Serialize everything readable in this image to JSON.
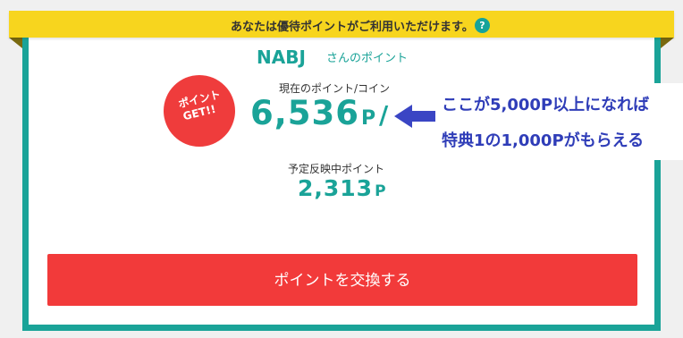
{
  "banner": {
    "text": "あなたは優待ポイントがご利用いただけます。",
    "help_icon": "?"
  },
  "user": {
    "name": "NABJ",
    "suffix": "さんのポイント"
  },
  "badge": {
    "line1": "ポイント",
    "line2": "GET!!"
  },
  "current_points": {
    "label": "現在のポイント/コイン",
    "value": "6,536",
    "unit": "P",
    "separator": "/"
  },
  "pending_points": {
    "label": "予定反映中ポイント",
    "value": "2,313",
    "unit": "P"
  },
  "annotation": {
    "line1": "ここが5,000P以上になれば",
    "line2": "特典1の1,000Pがもらえる",
    "arrow_icon": "left-arrow-icon"
  },
  "actions": {
    "exchange_label": "ポイントを交換する"
  },
  "colors": {
    "teal": "#1aa398",
    "banner_yellow": "#f7d51e",
    "red": "#f23a3a",
    "annotation_blue": "#2f3db8"
  }
}
